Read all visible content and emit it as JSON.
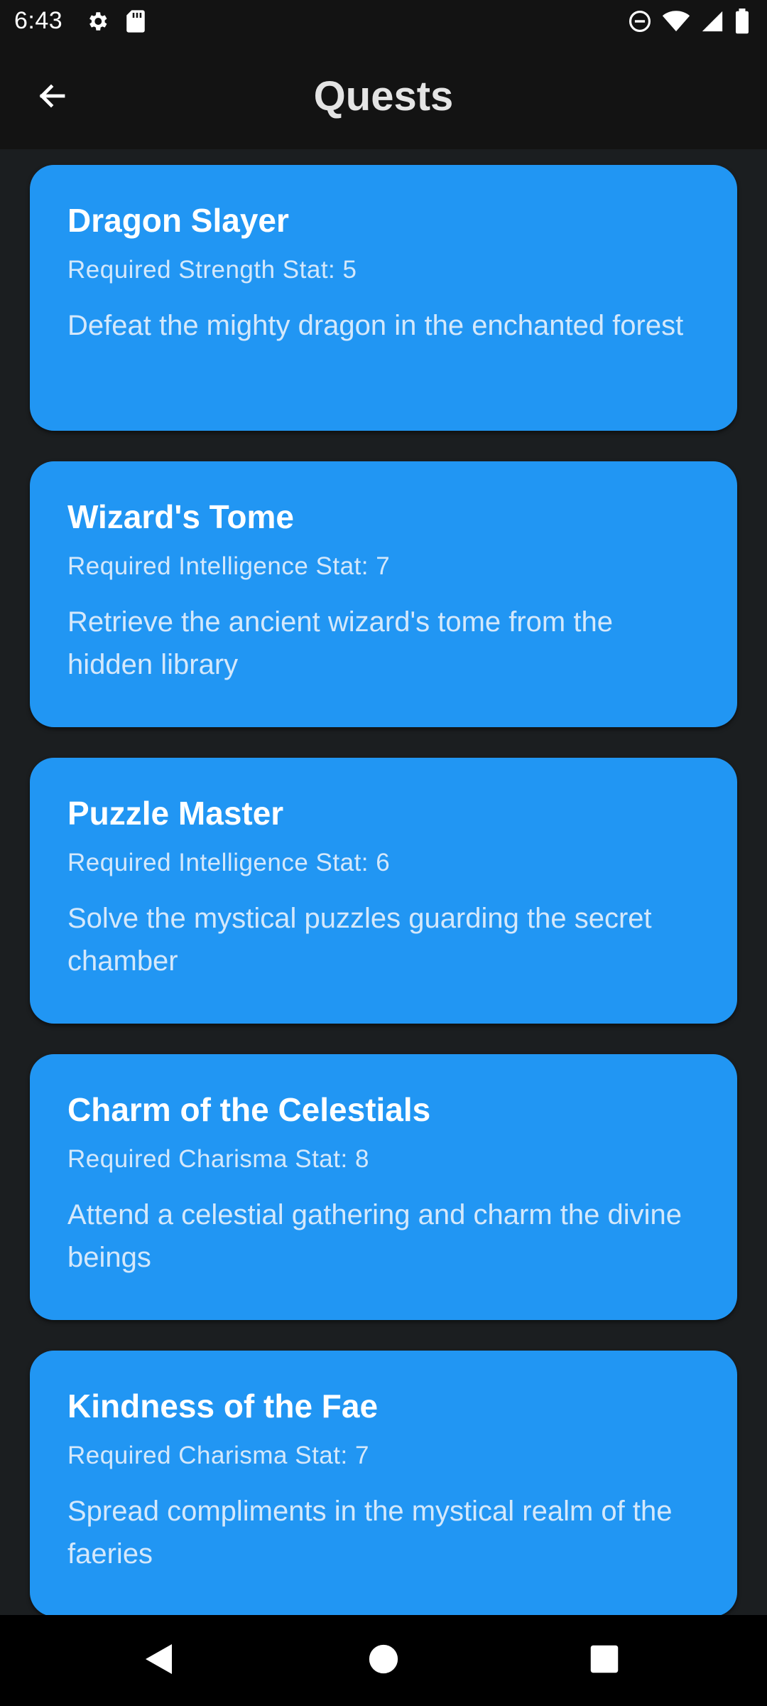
{
  "status_bar": {
    "time": "6:43",
    "left_icons": [
      "gear-icon",
      "sd-card-icon"
    ],
    "right_icons": [
      "do-not-disturb-icon",
      "wifi-icon",
      "signal-icon",
      "battery-icon"
    ]
  },
  "app_bar": {
    "back_icon": "arrow-left-icon",
    "title": "Quests"
  },
  "quests": [
    {
      "title": "Dragon Slayer",
      "requirement": "Required Strength Stat: 5",
      "description": "Defeat the mighty dragon in the enchanted forest"
    },
    {
      "title": "Wizard's Tome",
      "requirement": "Required Intelligence Stat: 7",
      "description": "Retrieve the ancient wizard's tome from the hidden library"
    },
    {
      "title": "Puzzle Master",
      "requirement": "Required Intelligence Stat: 6",
      "description": "Solve the mystical puzzles guarding the secret chamber"
    },
    {
      "title": "Charm of the Celestials",
      "requirement": "Required Charisma Stat: 8",
      "description": "Attend a celestial gathering and charm the divine beings"
    },
    {
      "title": "Kindness of the Fae",
      "requirement": "Required Charisma Stat: 7",
      "description": "Spread compliments in the mystical realm of the faeries"
    }
  ],
  "nav_bar": {
    "icons": [
      "back-triangle-icon",
      "home-circle-icon",
      "recents-square-icon"
    ]
  },
  "colors": {
    "card": "#2196f3",
    "background": "#1b1e20",
    "app_bar": "#131313",
    "card_text_secondary": "#d4e8fb"
  }
}
